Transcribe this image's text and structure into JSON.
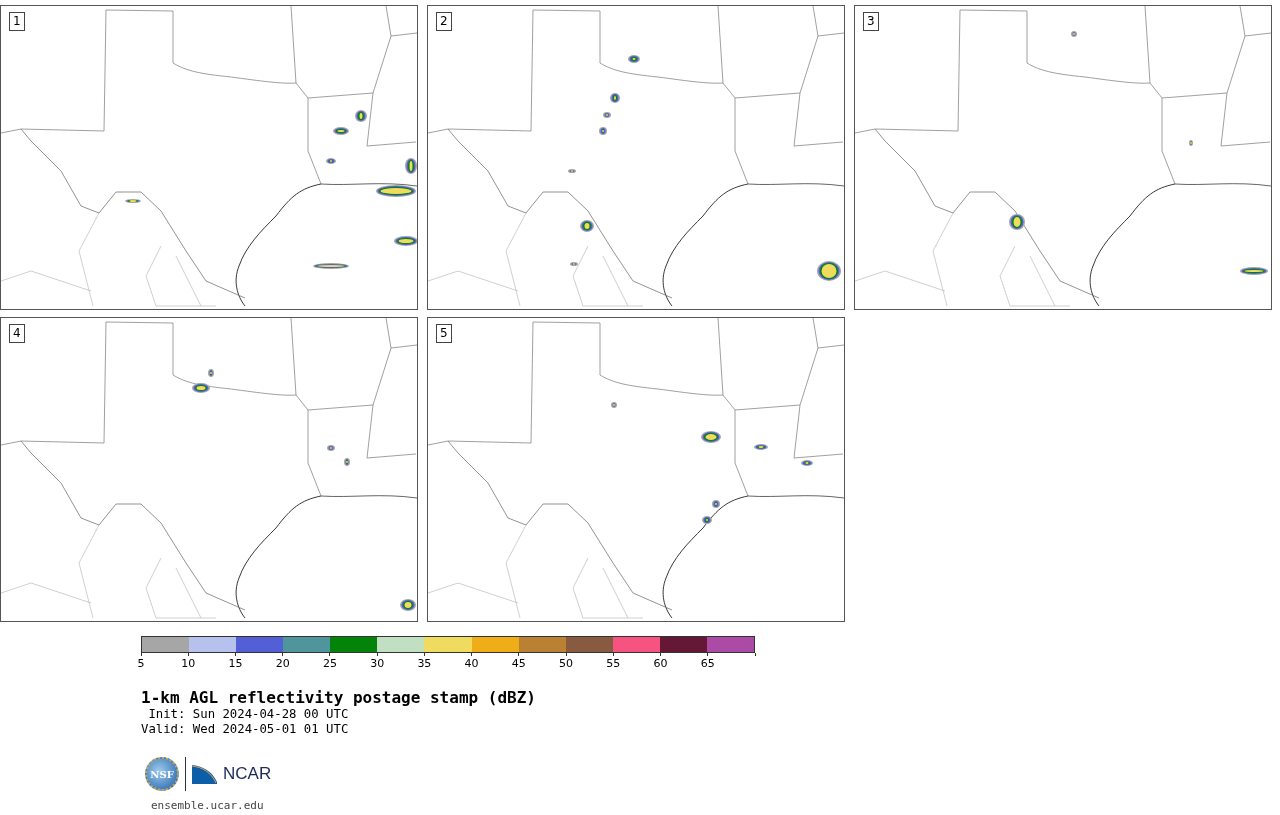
{
  "panels": [
    {
      "label": "1"
    },
    {
      "label": "2"
    },
    {
      "label": "3"
    },
    {
      "label": "4"
    },
    {
      "label": "5"
    }
  ],
  "colorbar": {
    "segments": [
      {
        "color": "#a6a6a6"
      },
      {
        "color": "#b7c1ee"
      },
      {
        "color": "#525fd7"
      },
      {
        "color": "#4f969c"
      },
      {
        "color": "#04830a"
      },
      {
        "color": "#c1e0c1"
      },
      {
        "color": "#efdb5e"
      },
      {
        "color": "#efad18"
      },
      {
        "color": "#b98131"
      },
      {
        "color": "#885a3f"
      },
      {
        "color": "#f75380"
      },
      {
        "color": "#641835"
      },
      {
        "color": "#ab4ba6"
      }
    ],
    "ticks": [
      "5",
      "10",
      "15",
      "20",
      "25",
      "30",
      "35",
      "40",
      "45",
      "50",
      "55",
      "60",
      "65"
    ]
  },
  "title": "1-km AGL reflectivity postage stamp (dBZ)",
  "init": " Init: Sun 2024-04-28 00 UTC",
  "valid": "Valid: Wed 2024-05-01 01 UTC",
  "logos": {
    "nsf": "NSF",
    "ncar": "NCAR"
  },
  "url": "ensemble.ucar.edu"
}
